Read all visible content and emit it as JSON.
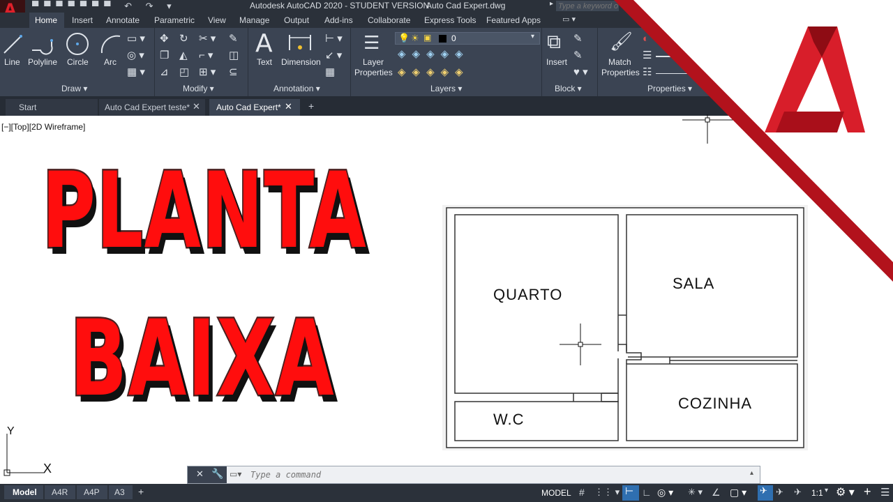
{
  "app": {
    "title": "Autodesk AutoCAD 2020 - STUDENT VERSION",
    "filename": "Auto Cad Expert.dwg",
    "search_placeholder": "Type a keyword o"
  },
  "ribbon_tabs": [
    "Home",
    "Insert",
    "Annotate",
    "Parametric",
    "View",
    "Manage",
    "Output",
    "Add-ins",
    "Collaborate",
    "Express Tools",
    "Featured Apps"
  ],
  "draw": {
    "panel": "Draw ▾",
    "line": "Line",
    "polyline": "Polyline",
    "circle": "Circle",
    "arc": "Arc"
  },
  "modify": {
    "panel": "Modify ▾"
  },
  "annotation": {
    "panel": "Annotation ▾",
    "text": "Text",
    "dimension": "Dimension"
  },
  "layers": {
    "panel": "Layers ▾",
    "layer_props_1": "Layer",
    "layer_props_2": "Properties",
    "current_layer": "0"
  },
  "block": {
    "panel": "Block ▾",
    "insert": "Insert"
  },
  "properties": {
    "panel": "Properties ▾",
    "match_1": "Match",
    "match_2": "Properties"
  },
  "doc_tabs": {
    "start": "Start",
    "tab1": "Auto Cad Expert teste*",
    "tab2": "Auto Cad Expert*"
  },
  "viewport_label": "[−][Top][2D Wireframe]",
  "headline": {
    "line1": "PLANTA",
    "line2": "BAIXA"
  },
  "plan": {
    "quarto": "QUARTO",
    "sala": "SALA",
    "wc": "W.C",
    "cozinha": "COZINHA"
  },
  "ucs": {
    "x": "X",
    "y": "Y"
  },
  "command": {
    "placeholder": "Type a command"
  },
  "layout_tabs": [
    "Model",
    "A4R",
    "A4P",
    "A3"
  ],
  "status": {
    "model": "MODEL",
    "scale": "1:1"
  },
  "colors": {
    "ribbon": "#3b4453",
    "titlebar": "#2b313a",
    "logo_red": "#c8102e",
    "headline_red": "#ff0d0d"
  }
}
